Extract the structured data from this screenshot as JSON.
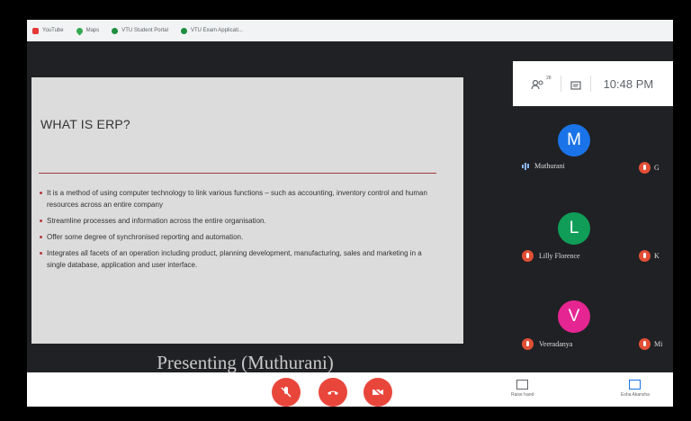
{
  "bookmarks": [
    {
      "label": "YouTube",
      "icon": "youtube-icon"
    },
    {
      "label": "Maps",
      "icon": "maps-icon"
    },
    {
      "label": "VTU Student Portal",
      "icon": "globe-icon"
    },
    {
      "label": "VTU Exam Applicati...",
      "icon": "globe-icon"
    }
  ],
  "header": {
    "time": "10:48 PM",
    "participants_badge": "28"
  },
  "slide": {
    "title": "WHAT IS ERP?",
    "bullets": [
      "It is a method of using computer technology to link various functions – such as accounting, inventory control and human resources across an entire company",
      "Streamline processes and information across the entire organisation.",
      "Offer some degree of synchronised reporting and automation.",
      "Integrates all facets of an operation including product, planning development, manufacturing, sales and marketing in a single database, application and user interface."
    ]
  },
  "presenting_label": "Presenting (Muthurani)",
  "participants": [
    {
      "initial": "M",
      "name": "Muthurani",
      "color": "#1a73e8",
      "speaking": true
    },
    {
      "initial": "L",
      "name": "Lilly Florence",
      "color": "#0f9d58",
      "speaking": false
    },
    {
      "initial": "V",
      "name": "Veeradanya",
      "color": "#e52592",
      "speaking": false
    }
  ],
  "edge_participants": [
    {
      "initial": "G"
    },
    {
      "initial": "K"
    },
    {
      "initial": "Mi"
    }
  ],
  "bottom": {
    "left_button_label": "Raise hand",
    "right_button_label": "Esha Akansha"
  },
  "colors": {
    "end_call": "#e9463b",
    "accent_blue": "#1a73e8"
  }
}
